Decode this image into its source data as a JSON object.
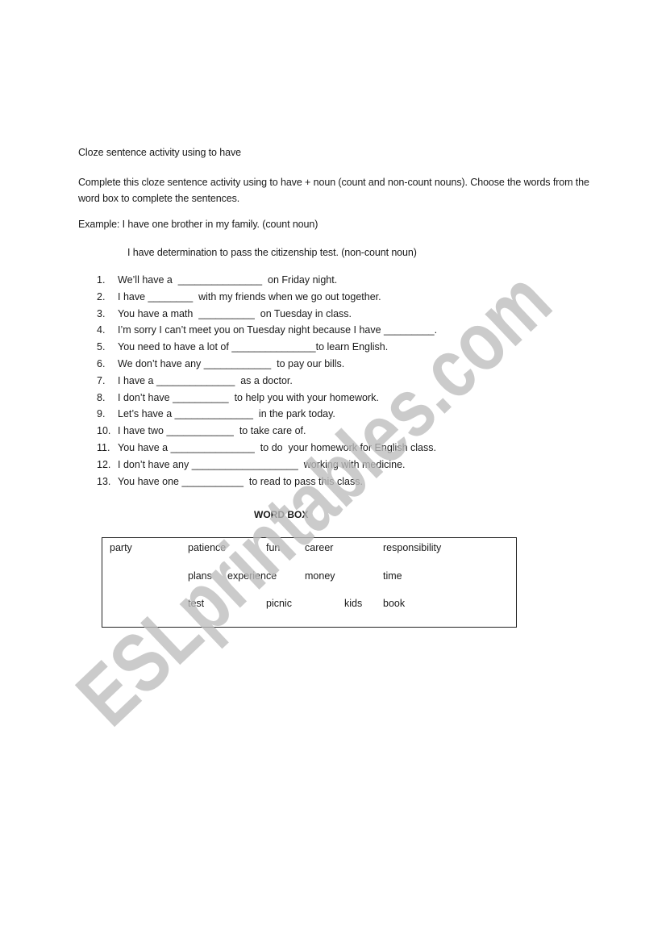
{
  "document": {
    "title": "Cloze sentence activity using to have",
    "instructions": "Complete this cloze sentence activity using to have + noun (count and non-count nouns).  Choose the words from the word box to complete the sentences.",
    "example_1": "Example:  I have one brother in my family.  (count noun)",
    "example_2": "I have determination to pass the citizenship test. (non-count noun)",
    "sentences": [
      {
        "num": "1.",
        "text": "We’ll have a  _______________  on Friday night."
      },
      {
        "num": "2.",
        "text": "I have ________  with my friends when we go out together."
      },
      {
        "num": "3.",
        "text": "You have a math  __________  on Tuesday in class."
      },
      {
        "num": "4.",
        "text": "I’m sorry I can’t meet you on Tuesday night because I have _________."
      },
      {
        "num": "5.",
        "text": "You need to have a lot of _______________to learn English."
      },
      {
        "num": "6.",
        "text": "We don’t have any ____________  to pay our bills."
      },
      {
        "num": "7.",
        "text": "I have a ______________  as a doctor."
      },
      {
        "num": "8.",
        "text": "I don’t have __________  to help you with your homework."
      },
      {
        "num": "9.",
        "text": "Let’s have a ______________  in the park today."
      },
      {
        "num": "10.",
        "text": "I have two ____________  to take care of."
      },
      {
        "num": "11.",
        "text": "You have a _______________  to do  your homework for English class."
      },
      {
        "num": "12.",
        "text": "I don’t have any ___________________  working with medicine."
      },
      {
        "num": "13.",
        "text": "You have one ___________  to read to pass this class."
      }
    ],
    "word_box": {
      "title": "WORD BOX",
      "words": [
        "party",
        "patience",
        "fun",
        "career",
        "responsibility",
        "plans",
        "experience",
        "money",
        "time",
        "test",
        "picnic",
        "kids",
        "book"
      ]
    },
    "watermark": "ESLprintables.com"
  }
}
